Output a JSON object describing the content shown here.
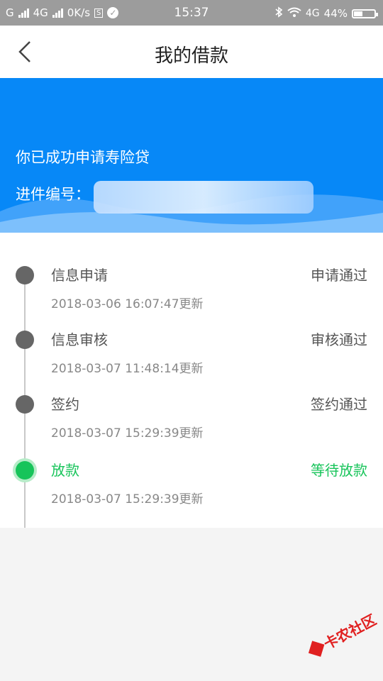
{
  "status_bar": {
    "carrier_left": "G",
    "network": "4G",
    "speed": "0K/s",
    "time": "15:37",
    "network_right": "4G",
    "battery_pct": "44%",
    "battery_level": 0.44
  },
  "nav": {
    "title": "我的借款"
  },
  "banner": {
    "message": "你已成功申请寿险贷",
    "application_no_label": "进件编号："
  },
  "timeline": {
    "steps": [
      {
        "name": "信息申请",
        "status": "申请通过",
        "time": "2018-03-06 16:07:47更新",
        "active": false
      },
      {
        "name": "信息审核",
        "status": "审核通过",
        "time": "2018-03-07 11:48:14更新",
        "active": false
      },
      {
        "name": "签约",
        "status": "签约通过",
        "time": "2018-03-07 15:29:39更新",
        "active": false
      },
      {
        "name": "放款",
        "status": "等待放款",
        "time": "2018-03-07 15:29:39更新",
        "active": true
      }
    ]
  },
  "watermark": {
    "text": "卡农社区"
  },
  "colors": {
    "banner_blue": "#0788f7",
    "active_green": "#17c45a",
    "dot_gray": "#666666"
  }
}
